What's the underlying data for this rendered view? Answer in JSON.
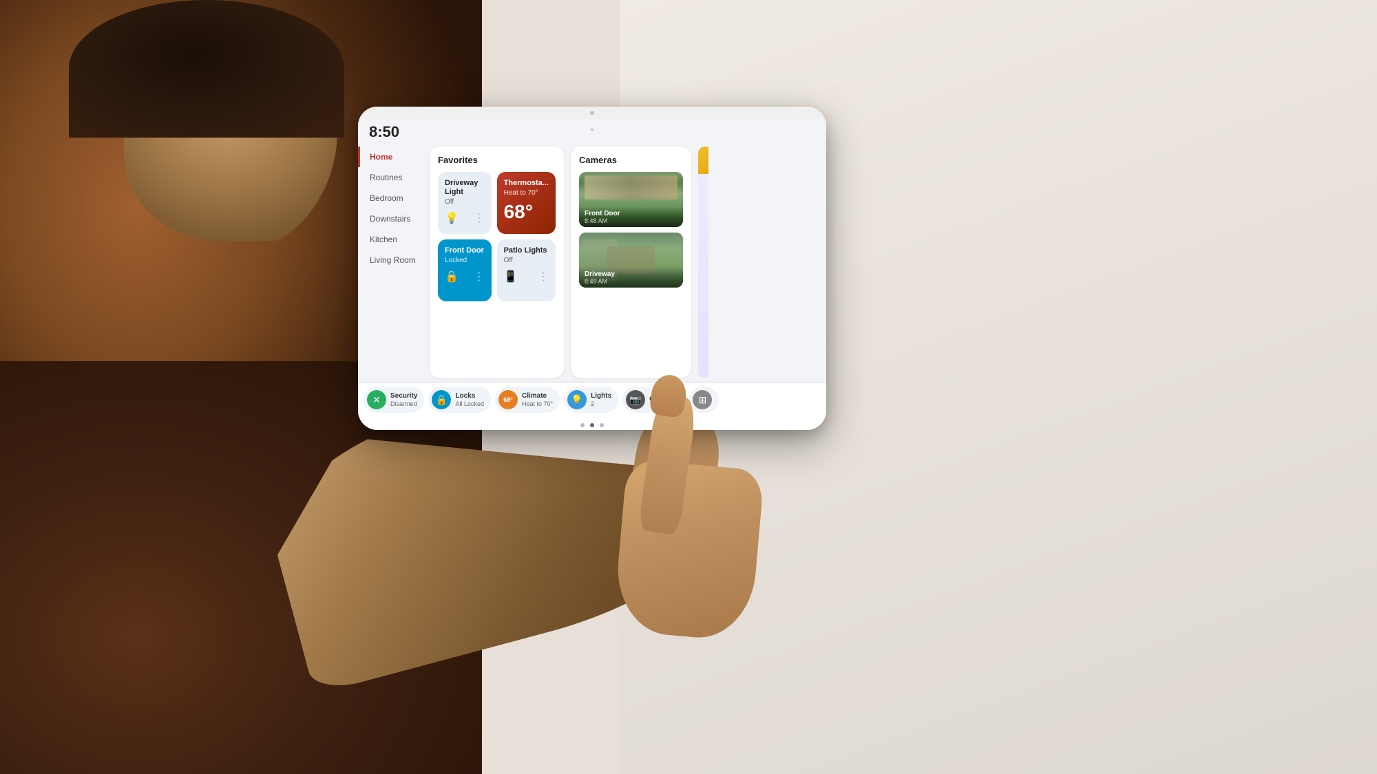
{
  "background": {
    "wall_color": "#e8e2da",
    "person_color": "#8b6340"
  },
  "tablet": {
    "time": "8:50",
    "nav_dots": [
      {
        "active": false
      },
      {
        "active": true
      },
      {
        "active": false
      }
    ]
  },
  "sidebar": {
    "items": [
      {
        "label": "Home",
        "active": true
      },
      {
        "label": "Routines",
        "active": false
      },
      {
        "label": "Bedroom",
        "active": false
      },
      {
        "label": "Downstairs",
        "active": false
      },
      {
        "label": "Kitchen",
        "active": false
      },
      {
        "label": "Living Room",
        "active": false
      }
    ]
  },
  "favorites": {
    "title": "Favorites",
    "tiles": [
      {
        "name": "Driveway Light",
        "status": "Off",
        "type": "light-off",
        "icon": "💡"
      },
      {
        "name": "Thermosta...",
        "status": "Heat to 70°",
        "temp": "68°",
        "type": "thermostat"
      },
      {
        "name": "Front Door",
        "status": "Locked",
        "type": "door-locked",
        "icon": "🔒"
      },
      {
        "name": "Patio Lights",
        "status": "Off",
        "type": "patio-off",
        "icon": "📱"
      }
    ]
  },
  "cameras": {
    "title": "Cameras",
    "feeds": [
      {
        "name": "Front Door",
        "time": "8:48 AM"
      },
      {
        "name": "Driveway",
        "time": "8:49 AM"
      }
    ]
  },
  "status_bar": {
    "chips": [
      {
        "label": "Security",
        "value": "Disarmed",
        "type": "security",
        "icon": "✕"
      },
      {
        "label": "Locks",
        "value": "All Locked",
        "type": "locks",
        "icon": "🔒"
      },
      {
        "label": "Climate",
        "value": "Heat to 70°",
        "type": "climate",
        "icon": "68°"
      },
      {
        "label": "Lights",
        "value": "2",
        "type": "lights",
        "icon": "💡"
      },
      {
        "label": "Cameras",
        "value": "",
        "type": "cameras",
        "icon": "📷"
      },
      {
        "label": "",
        "value": "",
        "type": "grid",
        "icon": "⊞"
      }
    ]
  }
}
